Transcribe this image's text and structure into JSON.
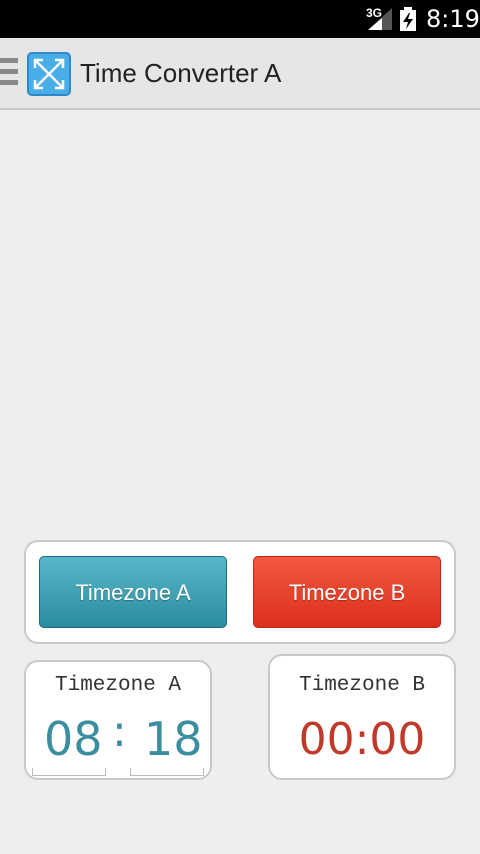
{
  "status_bar": {
    "network": "3G",
    "time": "8:19"
  },
  "action_bar": {
    "title": "Time Converter A"
  },
  "tz_buttons": {
    "a": "Timezone A",
    "b": "Timezone B"
  },
  "card_a": {
    "label": "Timezone A",
    "hour": "08",
    "separator": ":",
    "minute": "18"
  },
  "card_b": {
    "label": "Timezone B",
    "time": "00:00"
  },
  "colors": {
    "teal": "#2c8c9f",
    "red": "#dd301c",
    "time_a": "#3a8ea0",
    "time_b": "#c0392b"
  }
}
